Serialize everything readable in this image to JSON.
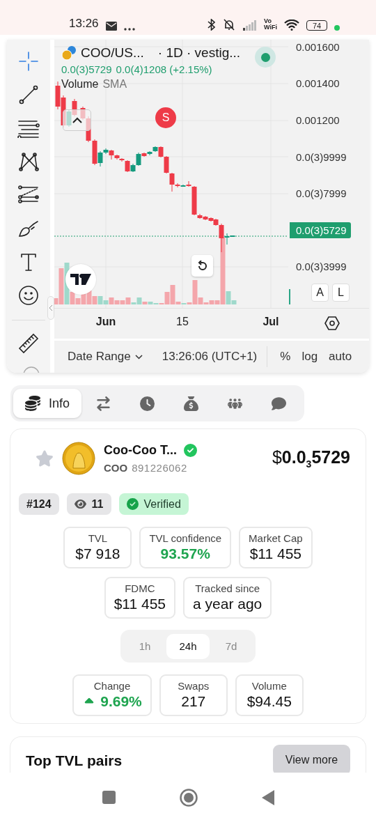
{
  "status_bar": {
    "time": "13:26",
    "network_label": [
      "Vo",
      "WiFi"
    ],
    "battery": "74"
  },
  "drawing_tools": [
    {
      "kind": "crosshair",
      "selected": true
    },
    {
      "kind": "trend-line",
      "selected": false
    },
    {
      "kind": "fib",
      "selected": false
    },
    {
      "kind": "pattern",
      "selected": false
    },
    {
      "kind": "forecast",
      "selected": false
    },
    {
      "kind": "brush",
      "selected": false
    },
    {
      "kind": "text",
      "selected": false
    },
    {
      "kind": "emoji",
      "selected": false
    },
    {
      "kind": "ruler",
      "selected": false
    }
  ],
  "chart": {
    "symbol": "COO/US...",
    "details": "· 1D · vestig...",
    "open": "0.0(3)5729",
    "change": "0.0(4)1208 (+2.15%)",
    "indicator": "Volume",
    "indicator_param": "SMA",
    "marker": "S",
    "price_axis": [
      {
        "kind": "tick",
        "label": "0.001600"
      },
      {
        "kind": "tick",
        "label": "0.001400"
      },
      {
        "kind": "tick",
        "label": "0.001200"
      },
      {
        "kind": "tick",
        "label": "0.0(3)9999"
      },
      {
        "kind": "tick",
        "label": "0.0(3)7999"
      },
      {
        "kind": "last",
        "label": "0.0(3)5729"
      },
      {
        "kind": "tick",
        "label": "0.0(3)3999"
      }
    ],
    "time_axis": [
      {
        "label": "Jun",
        "bold": true
      },
      {
        "label": "15",
        "bold": false
      },
      {
        "label": "Jul",
        "bold": true
      }
    ],
    "scale_buttons": [
      "A",
      "L"
    ]
  },
  "chart_footer": {
    "date_range": "Date Range",
    "time": "13:26:06 (UTC+1)",
    "percent": "%",
    "log": "log",
    "auto": "auto"
  },
  "tabs": [
    {
      "kind": "info",
      "label": "Info",
      "selected": true
    },
    {
      "kind": "swaps",
      "selected": false
    },
    {
      "kind": "history",
      "selected": false
    },
    {
      "kind": "money",
      "selected": false
    },
    {
      "kind": "holders",
      "selected": false
    },
    {
      "kind": "chat",
      "selected": false
    }
  ],
  "token": {
    "name": "Coo-Coo T...",
    "verified": true,
    "favorite": false,
    "symbol": "COO",
    "id": "891226062",
    "currency": "$",
    "price": "0.0$_{3}$5729"
  },
  "badges": [
    {
      "kind": "rank",
      "label": "#124"
    },
    {
      "kind": "views",
      "label": "11"
    },
    {
      "kind": "verified",
      "label": "Verified"
    }
  ],
  "stats": [
    [
      {
        "label": "TVL",
        "value": "$7 918",
        "positive": false
      },
      {
        "label": "TVL confidence",
        "value": "93.57%",
        "positive": true
      },
      {
        "label": "Market Cap",
        "value": "$11 455",
        "positive": false
      }
    ],
    [
      {
        "label": "FDMC",
        "value": "$11 455",
        "positive": false
      },
      {
        "label": "Tracked since",
        "value": "a year ago",
        "positive": false
      }
    ]
  ],
  "periods": [
    {
      "label": "1h",
      "selected": false
    },
    {
      "label": "24h",
      "selected": true
    },
    {
      "label": "7d",
      "selected": false
    }
  ],
  "period_stats": [
    {
      "label": "Change",
      "value": "9.69%",
      "rising": true
    },
    {
      "label": "Swaps",
      "value": "217",
      "rising": false
    },
    {
      "label": "Volume",
      "value": "$94.45",
      "rising": false
    }
  ],
  "pairs": {
    "title": "Top TVL pairs",
    "button": "View more"
  }
}
